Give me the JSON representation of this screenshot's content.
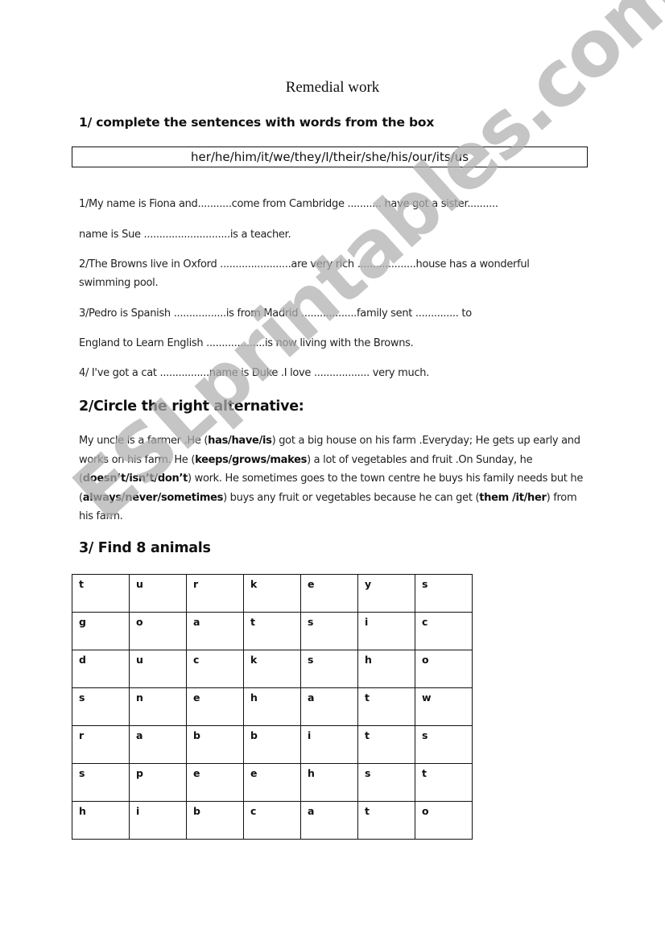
{
  "title": "Remedial work",
  "section1": {
    "heading": "1/ complete the sentences with words from the box",
    "word_box": "her/he/him/it/we/they/I/their/she/his/our/its/us",
    "lines": [
      " 1/My name is Fiona and...........come from Cambridge ........... have got a sister..........",
      "name is Sue ............................is a teacher.",
      "2/The Browns live in Oxford .......................are very rich ...................house has a wonderful",
      "swimming pool.",
      "3/Pedro is Spanish .................is from Madrid ..................family sent .............. to",
      "England to Learn English ...................is now living with the Browns.",
      "4/ I've  got a cat ................name is Duke .I love .................. very much."
    ]
  },
  "section2": {
    "heading": "2/Circle the right alternative:",
    "segments": [
      {
        "text": "My uncle is a farmer .He (",
        "bold": false
      },
      {
        "text": "has/have/is",
        "bold": true
      },
      {
        "text": ") got a big house on his farm .Everyday; He gets up early and works on his farm. He (",
        "bold": false
      },
      {
        "text": "keeps/grows/makes",
        "bold": true
      },
      {
        "text": ") a lot of vegetables and fruit .On Sunday, he (",
        "bold": false
      },
      {
        "text": "doesn’t/isn’t/don’t",
        "bold": true
      },
      {
        "text": ") work. He sometimes goes to the town centre he buys his family needs but he (",
        "bold": false
      },
      {
        "text": "always/never/sometimes",
        "bold": true
      },
      {
        "text": ") buys any fruit or vegetables because he can get (",
        "bold": false
      },
      {
        "text": "them /it/her",
        "bold": true
      },
      {
        "text": ") from his farm.",
        "bold": false
      }
    ]
  },
  "section3": {
    "heading": "3/ Find 8 animals",
    "grid": [
      [
        "t",
        "u",
        "r",
        "k",
        "e",
        "y",
        "s"
      ],
      [
        "g",
        "o",
        "a",
        "t",
        "s",
        "i",
        "c"
      ],
      [
        "d",
        "u",
        "c",
        "k",
        "s",
        "h",
        "o"
      ],
      [
        "s",
        "n",
        "e",
        "h",
        "a",
        "t",
        "w"
      ],
      [
        "r",
        "a",
        "b",
        "b",
        "i",
        "t",
        "s"
      ],
      [
        "s",
        "p",
        "e",
        "e",
        "h",
        "s",
        "t"
      ],
      [
        "h",
        "i",
        "b",
        "c",
        "a",
        "t",
        "o"
      ]
    ]
  },
  "watermark": "ESLprintables.com"
}
